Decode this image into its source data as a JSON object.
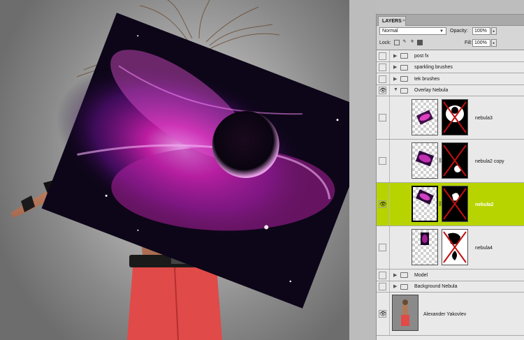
{
  "panel": {
    "tab_label": "LAYERS",
    "tab_close": "»",
    "blend_mode": "Normal",
    "opacity_label": "Opacity:",
    "opacity_value": "100%",
    "lock_label": "Lock:",
    "fill_label": "Fill:",
    "fill_value": "100%"
  },
  "layers": [
    {
      "name": "post fx",
      "type": "group",
      "visible": false
    },
    {
      "name": "sparkling brushes",
      "type": "group",
      "visible": false
    },
    {
      "name": "tek brushes",
      "type": "group",
      "visible": false
    },
    {
      "name": "Overlay Nebula",
      "type": "group",
      "visible": true,
      "expanded": true
    },
    {
      "name": "nebula3",
      "type": "layer",
      "visible": false
    },
    {
      "name": "nebula2 copy",
      "type": "layer",
      "visible": false
    },
    {
      "name": "nebula2",
      "type": "layer",
      "visible": true,
      "selected": true
    },
    {
      "name": "nebula4",
      "type": "layer",
      "visible": false
    },
    {
      "name": "Model",
      "type": "group",
      "visible": false
    },
    {
      "name": "Background Nebula",
      "type": "group",
      "visible": false
    },
    {
      "name": "Alexander Yakovlev",
      "type": "layer",
      "visible": true
    }
  ],
  "colors": {
    "selected_row": "#b8d400",
    "nebula_pink": "#e040c0",
    "nebula_purple": "#6a1a9a",
    "mask_cross": "#c01010",
    "pants": "#e04040"
  }
}
